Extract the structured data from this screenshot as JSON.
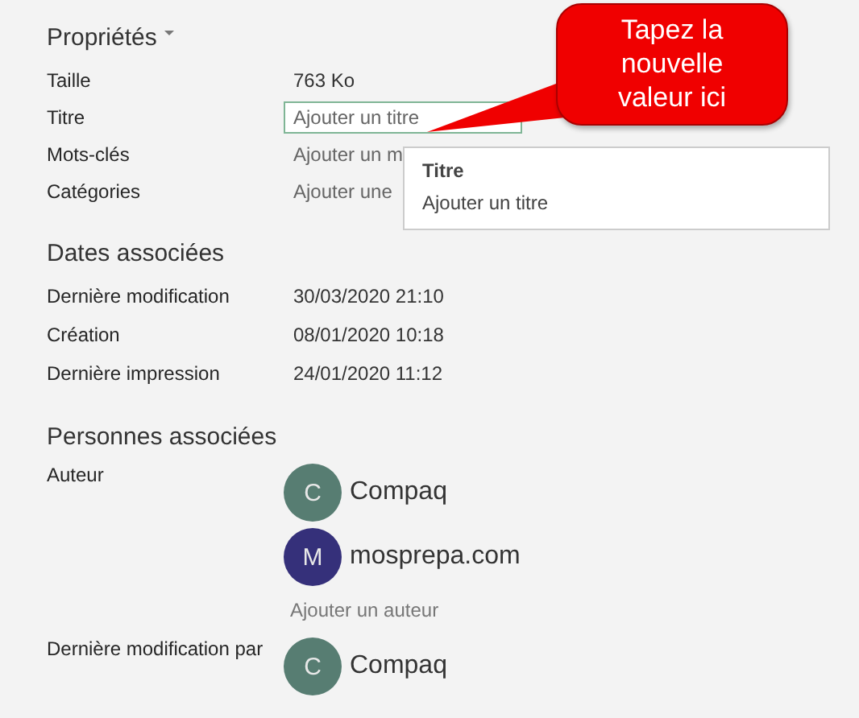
{
  "properties": {
    "title": "Propriétés",
    "rows": [
      {
        "label": "Taille",
        "kind": "text",
        "value": "763 Ko"
      },
      {
        "label": "Titre",
        "kind": "field",
        "placeholder": "Ajouter un titre"
      },
      {
        "label": "Mots-clés",
        "kind": "link",
        "value": "Ajouter un m"
      },
      {
        "label": "Catégories",
        "kind": "link",
        "value": "Ajouter une"
      }
    ]
  },
  "tooltip": {
    "title": "Titre",
    "text": "Ajouter un titre"
  },
  "callout": {
    "text": "Tapez la nouvelle valeur ici"
  },
  "dates": {
    "title": "Dates associées",
    "rows": [
      {
        "label": "Dernière modification",
        "value": "30/03/2020 21:10"
      },
      {
        "label": "Création",
        "value": "08/01/2020 10:18"
      },
      {
        "label": "Dernière impression",
        "value": "24/01/2020 11:12"
      }
    ]
  },
  "people": {
    "title": "Personnes associées",
    "groups": [
      {
        "label": "Auteur",
        "persons": [
          {
            "initial": "C",
            "name": "Compaq",
            "color": "#577d72"
          },
          {
            "initial": "M",
            "name": "mosprepa.com",
            "color": "#35307a"
          }
        ],
        "add_link": "Ajouter un auteur"
      },
      {
        "label": "Dernière modification par",
        "persons": [
          {
            "initial": "C",
            "name": "Compaq",
            "color": "#577d72"
          }
        ]
      }
    ]
  }
}
